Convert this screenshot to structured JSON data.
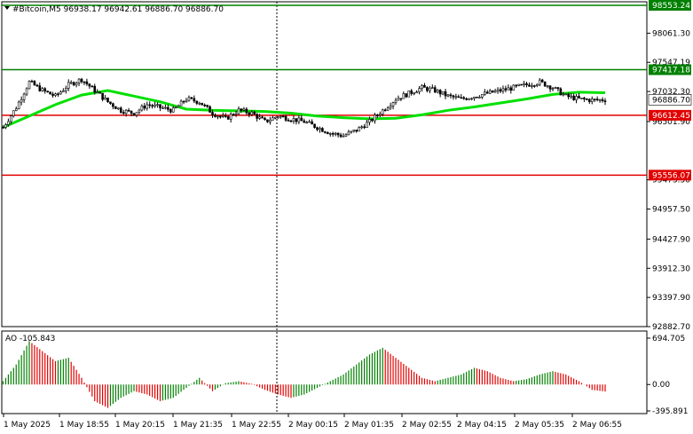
{
  "chart_data": [
    {
      "type": "candlestick",
      "header": "#Bitcoin,M5  96938.17 96942.61 96886.70 96886.70",
      "ylim": [
        92882.7,
        98553.24
      ],
      "y_ticks": [
        "98061.30",
        "97547.19",
        "97032.30",
        "96501.90",
        "95473.50",
        "94957.50",
        "94427.90",
        "93912.30",
        "93397.90",
        "92882.70"
      ],
      "x_ticks": [
        "1 May 2025",
        "1 May 18:55",
        "1 May 20:15",
        "1 May 21:35",
        "1 May 22:55",
        "2 May 00:15",
        "2 May 01:35",
        "2 May 02:55",
        "2 May 04:15",
        "2 May 05:35",
        "2 May 06:55"
      ],
      "current_price": "96886.70",
      "levels": [
        {
          "value": 98553.24,
          "label": "98553.24",
          "color": "#008000"
        },
        {
          "value": 97417.18,
          "label": "97417.18",
          "color": "#008000"
        },
        {
          "value": 96612.45,
          "label": "96612.45",
          "color": "#e00000"
        },
        {
          "value": 95556.07,
          "label": "95556.07",
          "color": "#e00000"
        }
      ],
      "moving_average": {
        "color": "#00e000",
        "x_index": [
          0,
          10,
          20,
          30,
          40,
          50,
          60,
          70,
          80,
          90,
          100,
          110,
          120,
          130,
          140,
          150,
          160,
          170,
          180,
          190,
          200,
          210,
          220,
          230
        ],
        "y": [
          96400,
          96600,
          96800,
          96970,
          97050,
          96950,
          96850,
          96720,
          96700,
          96690,
          96680,
          96650,
          96600,
          96570,
          96550,
          96560,
          96620,
          96700,
          96760,
          96830,
          96900,
          96980,
          97020,
          97010
        ]
      },
      "series_close_anchors": {
        "x_index": [
          0,
          5,
          10,
          15,
          20,
          25,
          30,
          35,
          40,
          45,
          50,
          55,
          60,
          65,
          70,
          75,
          80,
          85,
          90,
          95,
          100,
          105,
          110,
          115,
          120,
          125,
          130,
          135,
          140,
          145,
          150,
          155,
          160,
          165,
          170,
          175,
          180,
          185,
          190,
          195,
          200,
          205,
          210,
          215,
          220,
          225,
          230
        ],
        "y": [
          96400,
          96750,
          97200,
          97050,
          96950,
          97150,
          97250,
          97050,
          96850,
          96700,
          96650,
          96800,
          96750,
          96700,
          96900,
          96850,
          96650,
          96550,
          96700,
          96650,
          96500,
          96600,
          96550,
          96500,
          96400,
          96300,
          96250,
          96350,
          96500,
          96700,
          96900,
          97000,
          97100,
          97050,
          96950,
          96900,
          96950,
          97000,
          97050,
          97100,
          97150,
          97200,
          97100,
          96950,
          96900,
          96880,
          96886.7
        ]
      }
    },
    {
      "type": "bar",
      "title": "AO -105.843",
      "ylim": [
        -395.891,
        694.705
      ],
      "y_ticks": [
        "694.705",
        "0.00",
        "-395.891"
      ],
      "x_index": [
        0,
        5,
        10,
        15,
        20,
        25,
        30,
        35,
        40,
        45,
        50,
        55,
        60,
        65,
        70,
        75,
        80,
        85,
        90,
        95,
        100,
        105,
        110,
        115,
        120,
        125,
        130,
        135,
        140,
        145,
        150,
        155,
        160,
        165,
        170,
        175,
        180,
        185,
        190,
        195,
        200,
        205,
        210,
        215,
        220,
        225,
        230
      ],
      "values": [
        50,
        300,
        650,
        500,
        350,
        400,
        100,
        -250,
        -350,
        -200,
        -100,
        -150,
        -250,
        -200,
        -50,
        100,
        -100,
        20,
        50,
        10,
        -80,
        -150,
        -200,
        -150,
        -50,
        50,
        150,
        300,
        450,
        550,
        400,
        250,
        100,
        50,
        100,
        150,
        250,
        200,
        100,
        50,
        80,
        150,
        200,
        150,
        50,
        -80,
        -106
      ],
      "up_color": "#008000",
      "down_color": "#e00000"
    }
  ]
}
